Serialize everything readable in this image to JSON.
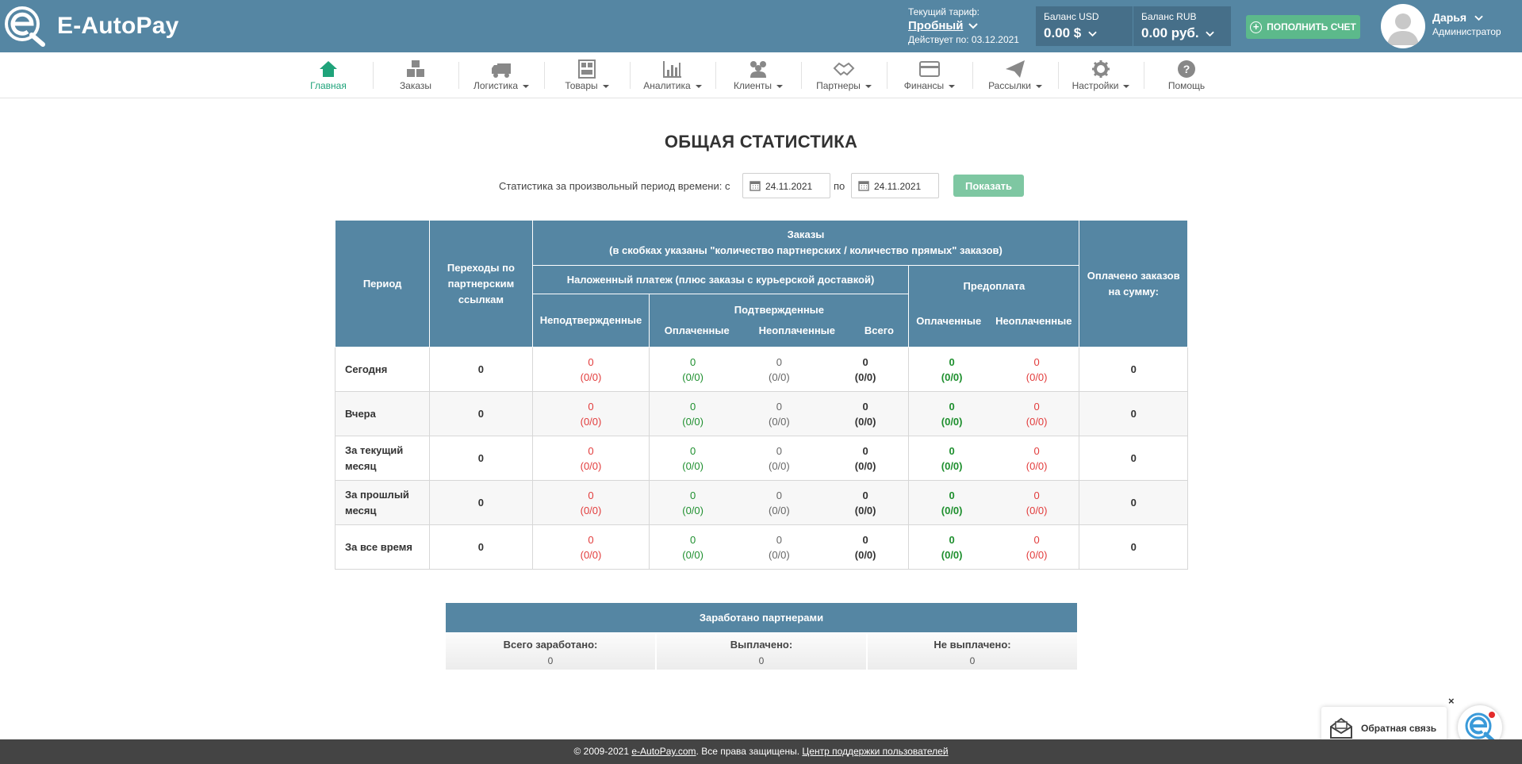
{
  "app": {
    "name": "E-AutoPay"
  },
  "tariff": {
    "label": "Текущий тариф:",
    "plan": "Пробный",
    "valid": "Действует по: 03.12.2021"
  },
  "balances": [
    {
      "title": "Баланс USD",
      "value": "0.00 $"
    },
    {
      "title": "Баланс RUB",
      "value": "0.00 руб."
    }
  ],
  "topup_label": "ПОПОЛНИТЬ СЧЕТ",
  "user": {
    "name": "Дарья",
    "role": "Администратор"
  },
  "nav": [
    {
      "label": "Главная",
      "icon": "home-icon",
      "active": true
    },
    {
      "label": "Заказы",
      "icon": "boxes-icon"
    },
    {
      "label": "Логистика",
      "icon": "truck-icon"
    },
    {
      "label": "Товары",
      "icon": "shelves-icon"
    },
    {
      "label": "Аналитика",
      "icon": "bar-chart-icon"
    },
    {
      "label": "Клиенты",
      "icon": "users-icon"
    },
    {
      "label": "Партнеры",
      "icon": "handshake-icon"
    },
    {
      "label": "Финансы",
      "icon": "credit-card-icon"
    },
    {
      "label": "Рассылки",
      "icon": "paper-plane-icon"
    },
    {
      "label": "Настройки",
      "icon": "gear-icon"
    },
    {
      "label": "Помощь",
      "icon": "help-icon"
    }
  ],
  "page_title": "ОБЩАЯ СТАТИСТИКА",
  "filter": {
    "label": "Статистика за произвольный период времени: с",
    "from": "24.11.2021",
    "to_label": "по",
    "to": "24.11.2021",
    "button": "Показать"
  },
  "table": {
    "headers": {
      "period": "Период",
      "transitions": "Переходы по партнерским ссылкам",
      "orders_title": "Заказы",
      "orders_note": "(в скобках указаны \"количество партнерских / количество прямых\" заказов)",
      "cod": "Наложенный платеж (плюс заказы с курьерской доставкой)",
      "prepay": "Предоплата",
      "paid_sum": "Оплачено заказов на сумму:",
      "unconfirmed": "Неподтвержденные",
      "confirmed": "Подтвержденные",
      "paid": "Оплаченные",
      "unpaid": "Неоплаченные",
      "total": "Всего",
      "pre_paid": "Оплаченные",
      "pre_unpaid": "Неоплаченные"
    },
    "rows": [
      {
        "period": "Сегодня",
        "transitions": "0",
        "unconfirmed": "0",
        "unconfirmed_sub": "(0/0)",
        "paid": "0",
        "paid_sub": "(0/0)",
        "unpaid": "0",
        "unpaid_sub": "(0/0)",
        "total": "0",
        "total_sub": "(0/0)",
        "pre_paid": "0",
        "pre_paid_sub": "(0/0)",
        "pre_unpaid": "0",
        "pre_unpaid_sub": "(0/0)",
        "sum": "0"
      },
      {
        "period": "Вчера",
        "transitions": "0",
        "unconfirmed": "0",
        "unconfirmed_sub": "(0/0)",
        "paid": "0",
        "paid_sub": "(0/0)",
        "unpaid": "0",
        "unpaid_sub": "(0/0)",
        "total": "0",
        "total_sub": "(0/0)",
        "pre_paid": "0",
        "pre_paid_sub": "(0/0)",
        "pre_unpaid": "0",
        "pre_unpaid_sub": "(0/0)",
        "sum": "0"
      },
      {
        "period": "За текущий месяц",
        "transitions": "0",
        "unconfirmed": "0",
        "unconfirmed_sub": "(0/0)",
        "paid": "0",
        "paid_sub": "(0/0)",
        "unpaid": "0",
        "unpaid_sub": "(0/0)",
        "total": "0",
        "total_sub": "(0/0)",
        "pre_paid": "0",
        "pre_paid_sub": "(0/0)",
        "pre_unpaid": "0",
        "pre_unpaid_sub": "(0/0)",
        "sum": "0"
      },
      {
        "period": "За прошлый месяц",
        "transitions": "0",
        "unconfirmed": "0",
        "unconfirmed_sub": "(0/0)",
        "paid": "0",
        "paid_sub": "(0/0)",
        "unpaid": "0",
        "unpaid_sub": "(0/0)",
        "total": "0",
        "total_sub": "(0/0)",
        "pre_paid": "0",
        "pre_paid_sub": "(0/0)",
        "pre_unpaid": "0",
        "pre_unpaid_sub": "(0/0)",
        "sum": "0"
      },
      {
        "period": "За все время",
        "transitions": "0",
        "unconfirmed": "0",
        "unconfirmed_sub": "(0/0)",
        "paid": "0",
        "paid_sub": "(0/0)",
        "unpaid": "0",
        "unpaid_sub": "(0/0)",
        "total": "0",
        "total_sub": "(0/0)",
        "pre_paid": "0",
        "pre_paid_sub": "(0/0)",
        "pre_unpaid": "0",
        "pre_unpaid_sub": "(0/0)",
        "sum": "0"
      }
    ]
  },
  "partners": {
    "title": "Заработано партнерами",
    "cols": [
      {
        "label": "Всего заработано:",
        "value": "0"
      },
      {
        "label": "Выплачено:",
        "value": "0"
      },
      {
        "label": "Не выплачено:",
        "value": "0"
      }
    ]
  },
  "footer": {
    "prefix": "© 2009-2021",
    "link": "e-AutoPay.com",
    "middle": ". Все права защищены.",
    "support": "Центр поддержки пользователей"
  },
  "feedback": {
    "label": "Обратная связь",
    "close": "×"
  },
  "colors": {
    "header": "#5586a3",
    "accent_green": "#1fa37a",
    "button_green": "#5cb98b",
    "red": "#e23b3b",
    "green": "#1e8f2e"
  }
}
